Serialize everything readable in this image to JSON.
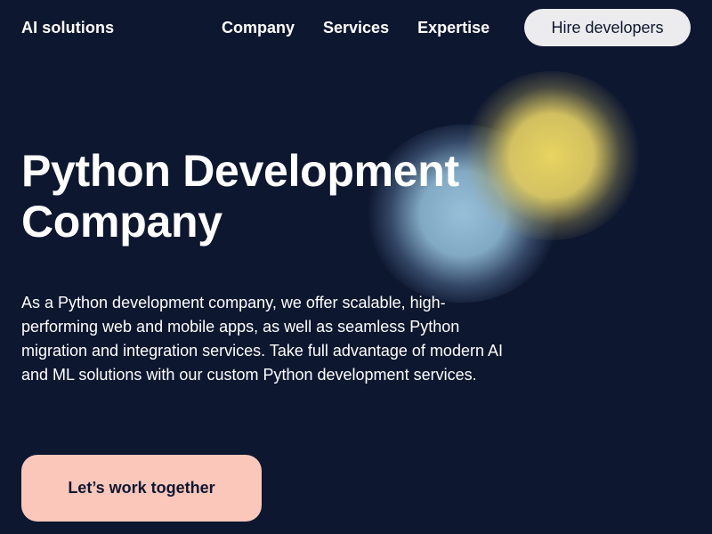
{
  "header": {
    "logo_text": "AI solutions",
    "nav": [
      {
        "label": "Company"
      },
      {
        "label": "Services"
      },
      {
        "label": "Expertise"
      }
    ],
    "hire_button_label": "Hire developers"
  },
  "hero": {
    "title_line1": "Python Development",
    "title_line2": "Company",
    "description": "As a Python development company, we offer scalable, high-performing web and mobile apps, as well as seamless Python migration and integration services. Take full advantage of modern AI and ML solutions with our custom Python development services.",
    "cta_label": "Let’s work together"
  },
  "colors": {
    "background": "#0e1730",
    "hire_button_bg": "#ececee",
    "cta_bg": "#fbc7bb",
    "blob_blue": "#a0c8e1",
    "blob_yellow": "#e8d460"
  }
}
